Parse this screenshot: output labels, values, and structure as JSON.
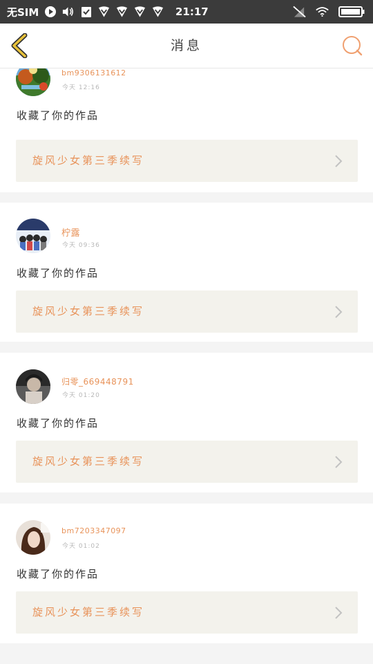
{
  "status_bar": {
    "carrier": "无SIM",
    "time": "21:17"
  },
  "header": {
    "title": "消息"
  },
  "colors": {
    "accent": "#e8935a",
    "back_arrow": "#e8c23a",
    "work_bg": "#f3f2ec"
  },
  "messages": [
    {
      "username": "bm9306131612",
      "time": "今天 12:16",
      "action": "收藏了你的作品",
      "work_title": "旋风少女第三季续写"
    },
    {
      "username": "柠露",
      "time": "今天 09:36",
      "action": "收藏了你的作品",
      "work_title": "旋风少女第三季续写"
    },
    {
      "username": "归零_669448791",
      "time": "今天 01:20",
      "action": "收藏了你的作品",
      "work_title": "旋风少女第三季续写"
    },
    {
      "username": "bm7203347097",
      "time": "今天 01:02",
      "action": "收藏了你的作品",
      "work_title": "旋风少女第三季续写"
    }
  ]
}
